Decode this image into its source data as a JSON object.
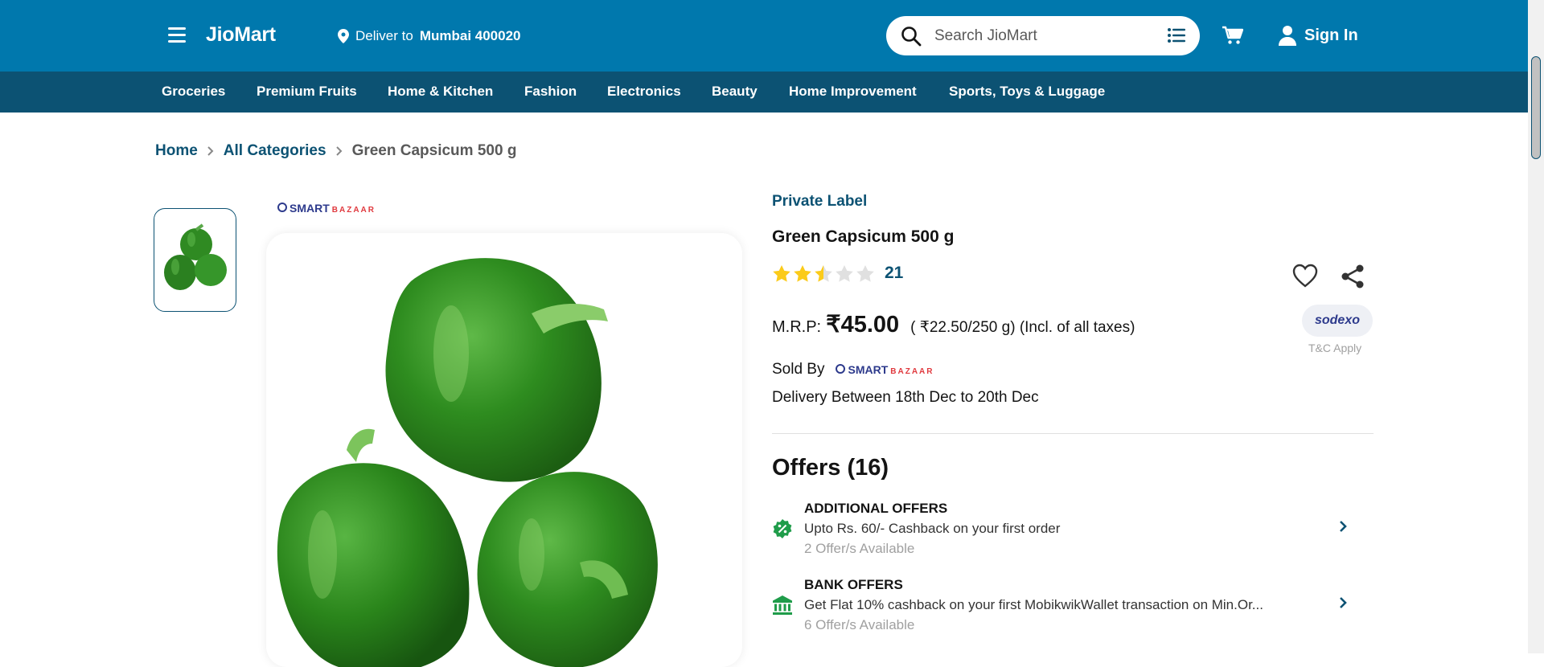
{
  "header": {
    "logo": "JioMart",
    "deliver_prefix": "Deliver to",
    "deliver_location": "Mumbai 400020",
    "search_placeholder": "Search JioMart",
    "signin_label": "Sign In",
    "bg_color": "#0078ad"
  },
  "categories": [
    "Groceries",
    "Premium Fruits",
    "Home & Kitchen",
    "Fashion",
    "Electronics",
    "Beauty",
    "Home Improvement",
    "Sports, Toys & Luggage"
  ],
  "breadcrumb": {
    "home": "Home",
    "all_categories": "All Categories",
    "current": "Green Capsicum 500 g"
  },
  "brand_logo": {
    "primary": "SMART",
    "secondary": "BAZAAR"
  },
  "product": {
    "label": "Private Label",
    "title": "Green Capsicum 500 g",
    "rating_stars": 2.5,
    "rating_count": "21",
    "mrp_label": "M.R.P:",
    "price": "₹45.00",
    "unit_price": "( ₹22.50/250 g) (Incl. of all taxes)",
    "sodexo_label": "sodexo",
    "tnc": "T&C Apply",
    "sold_by_label": "Sold By",
    "delivery": "Delivery Between 18th Dec to 20th Dec"
  },
  "offers": {
    "title": "Offers (16)",
    "items": [
      {
        "heading": "ADDITIONAL OFFERS",
        "description": "Upto Rs. 60/- Cashback on your first order",
        "count": "2 Offer/s Available",
        "icon": "discount-badge-icon"
      },
      {
        "heading": "BANK OFFERS",
        "description": "Get Flat 10% cashback on your first MobikwikWallet transaction on Min.Or...",
        "count": "6 Offer/s Available",
        "icon": "bank-icon"
      }
    ]
  }
}
